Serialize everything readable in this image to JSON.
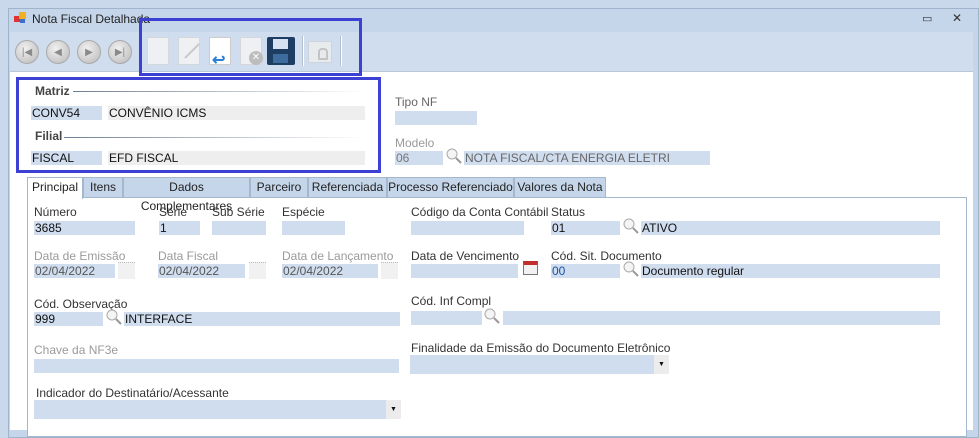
{
  "window": {
    "title": "Nota Fiscal Detalhada",
    "minimize": "▭",
    "close": "✕"
  },
  "toolbar": {
    "buttons": [
      "first",
      "previous",
      "next",
      "last",
      "new",
      "edit",
      "undo",
      "delete",
      "save",
      "lock"
    ]
  },
  "header": {
    "matriz_label": "Matriz",
    "matriz_code": "CONV54",
    "matriz_name": "CONVÊNIO ICMS",
    "filial_label": "Filial",
    "filial_code": "FISCAL",
    "filial_name": "EFD FISCAL",
    "tipo_nf_label": "Tipo NF",
    "tipo_nf_value": "",
    "modelo_label": "Modelo",
    "modelo_code": "06",
    "modelo_name": "NOTA FISCAL/CTA ENERGIA ELETRI"
  },
  "tabs": [
    "Principal",
    "Itens",
    "Dados Complementares",
    "Parceiro",
    "Referenciada",
    "Processo Referenciado",
    "Valores da Nota"
  ],
  "form": {
    "numero_label": "Número",
    "numero": "3685",
    "serie_label": "Série",
    "serie": "1",
    "sub_serie_label": "Sub Série",
    "sub_serie": "",
    "especie_label": "Espécie",
    "especie": "",
    "conta_label": "Código da Conta Contábil",
    "conta": "",
    "status_label": "Status",
    "status_code": "01",
    "status_name": "ATIVO",
    "data_emissao_label": "Data de Emissão",
    "data_emissao": "02/04/2022",
    "data_fiscal_label": "Data Fiscal",
    "data_fiscal": "02/04/2022",
    "data_lancamento_label": "Data de Lançamento",
    "data_lancamento": "02/04/2022",
    "data_vencimento_label": "Data de Vencimento",
    "data_vencimento": "",
    "sit_doc_label": "Cód. Sit. Documento",
    "sit_doc_code": "00",
    "sit_doc_name": "Documento regular",
    "obs_label": "Cód. Observação",
    "obs_code": "999",
    "obs_name": "INTERFACE",
    "inf_compl_label": "Cód. Inf Compl",
    "inf_compl_code": "",
    "inf_compl_name": "",
    "chave_label": "Chave da NF3e",
    "chave": "",
    "finalidade_label": "Finalidade da Emissão do Documento Eletrônico",
    "finalidade": "",
    "indicador_label": "Indicador do Destinatário/Acessante",
    "indicador": ""
  },
  "colors": {
    "field": "#d0ddef",
    "highlight": "#3d41d3"
  }
}
